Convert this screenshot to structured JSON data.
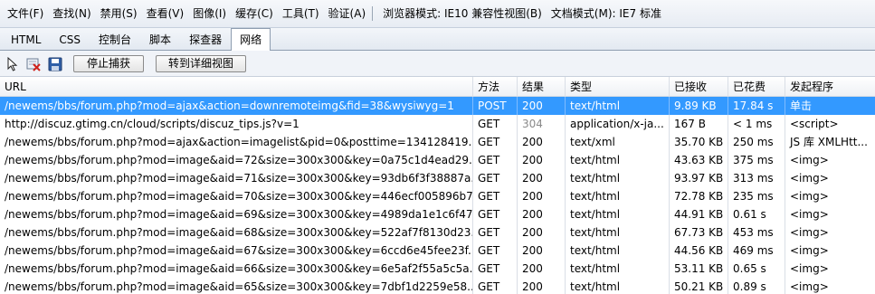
{
  "menu": {
    "items": [
      "文件(F)",
      "查找(N)",
      "禁用(S)",
      "查看(V)",
      "图像(I)",
      "缓存(C)",
      "工具(T)",
      "验证(A)"
    ],
    "browser_mode": "浏览器模式: IE10 兼容性视图(B)",
    "doc_mode": "文档模式(M): IE7 标准"
  },
  "tabs": [
    "HTML",
    "CSS",
    "控制台",
    "脚本",
    "探查器",
    "网络"
  ],
  "active_tab": "网络",
  "toolbar": {
    "stop_capture": "停止捕获",
    "detail_view": "转到详细视图",
    "icons": [
      "cursor-icon",
      "clear-entries-icon",
      "save-icon"
    ]
  },
  "table": {
    "headers": [
      "URL",
      "方法",
      "结果",
      "类型",
      "已接收",
      "已花费",
      "发起程序"
    ],
    "rows": [
      {
        "url": "/newems/bbs/forum.php?mod=ajax&action=downremoteimg&fid=38&wysiwyg=1",
        "method": "POST",
        "result": "200",
        "type": "text/html",
        "received": "9.89 KB",
        "time": "17.84 s",
        "initiator": "单击"
      },
      {
        "url": "http://discuz.gtimg.cn/cloud/scripts/discuz_tips.js?v=1",
        "method": "GET",
        "result": "304",
        "type": "application/x-ja...",
        "received": "167 B",
        "time": "< 1 ms",
        "initiator": "<script>"
      },
      {
        "url": "/newems/bbs/forum.php?mod=ajax&action=imagelist&pid=0&posttime=134128419...",
        "method": "GET",
        "result": "200",
        "type": "text/xml",
        "received": "35.70 KB",
        "time": "250 ms",
        "initiator": "JS 库 XMLHtt..."
      },
      {
        "url": "/newems/bbs/forum.php?mod=image&aid=72&size=300x300&key=0a75c1d4ead29...",
        "method": "GET",
        "result": "200",
        "type": "text/html",
        "received": "43.63 KB",
        "time": "375 ms",
        "initiator": "<img>"
      },
      {
        "url": "/newems/bbs/forum.php?mod=image&aid=71&size=300x300&key=93db6f3f38887a...",
        "method": "GET",
        "result": "200",
        "type": "text/html",
        "received": "93.97 KB",
        "time": "313 ms",
        "initiator": "<img>"
      },
      {
        "url": "/newems/bbs/forum.php?mod=image&aid=70&size=300x300&key=446ecf005896b7...",
        "method": "GET",
        "result": "200",
        "type": "text/html",
        "received": "72.78 KB",
        "time": "235 ms",
        "initiator": "<img>"
      },
      {
        "url": "/newems/bbs/forum.php?mod=image&aid=69&size=300x300&key=4989da1e1c6f47...",
        "method": "GET",
        "result": "200",
        "type": "text/html",
        "received": "44.91 KB",
        "time": "0.61 s",
        "initiator": "<img>"
      },
      {
        "url": "/newems/bbs/forum.php?mod=image&aid=68&size=300x300&key=522af7f8130d23...",
        "method": "GET",
        "result": "200",
        "type": "text/html",
        "received": "67.73 KB",
        "time": "453 ms",
        "initiator": "<img>"
      },
      {
        "url": "/newems/bbs/forum.php?mod=image&aid=67&size=300x300&key=6ccd6e45fee23f...",
        "method": "GET",
        "result": "200",
        "type": "text/html",
        "received": "44.56 KB",
        "time": "469 ms",
        "initiator": "<img>"
      },
      {
        "url": "/newems/bbs/forum.php?mod=image&aid=66&size=300x300&key=6e5af2f55a5c5a...",
        "method": "GET",
        "result": "200",
        "type": "text/html",
        "received": "53.11 KB",
        "time": "0.65 s",
        "initiator": "<img>"
      },
      {
        "url": "/newems/bbs/forum.php?mod=image&aid=65&size=300x300&key=7dbf1d2259e58...",
        "method": "GET",
        "result": "200",
        "type": "text/html",
        "received": "50.21 KB",
        "time": "0.89 s",
        "initiator": "<img>"
      }
    ]
  },
  "colors": {
    "selected_row": "#3399ff",
    "dim_text": "#8a8a8a"
  }
}
